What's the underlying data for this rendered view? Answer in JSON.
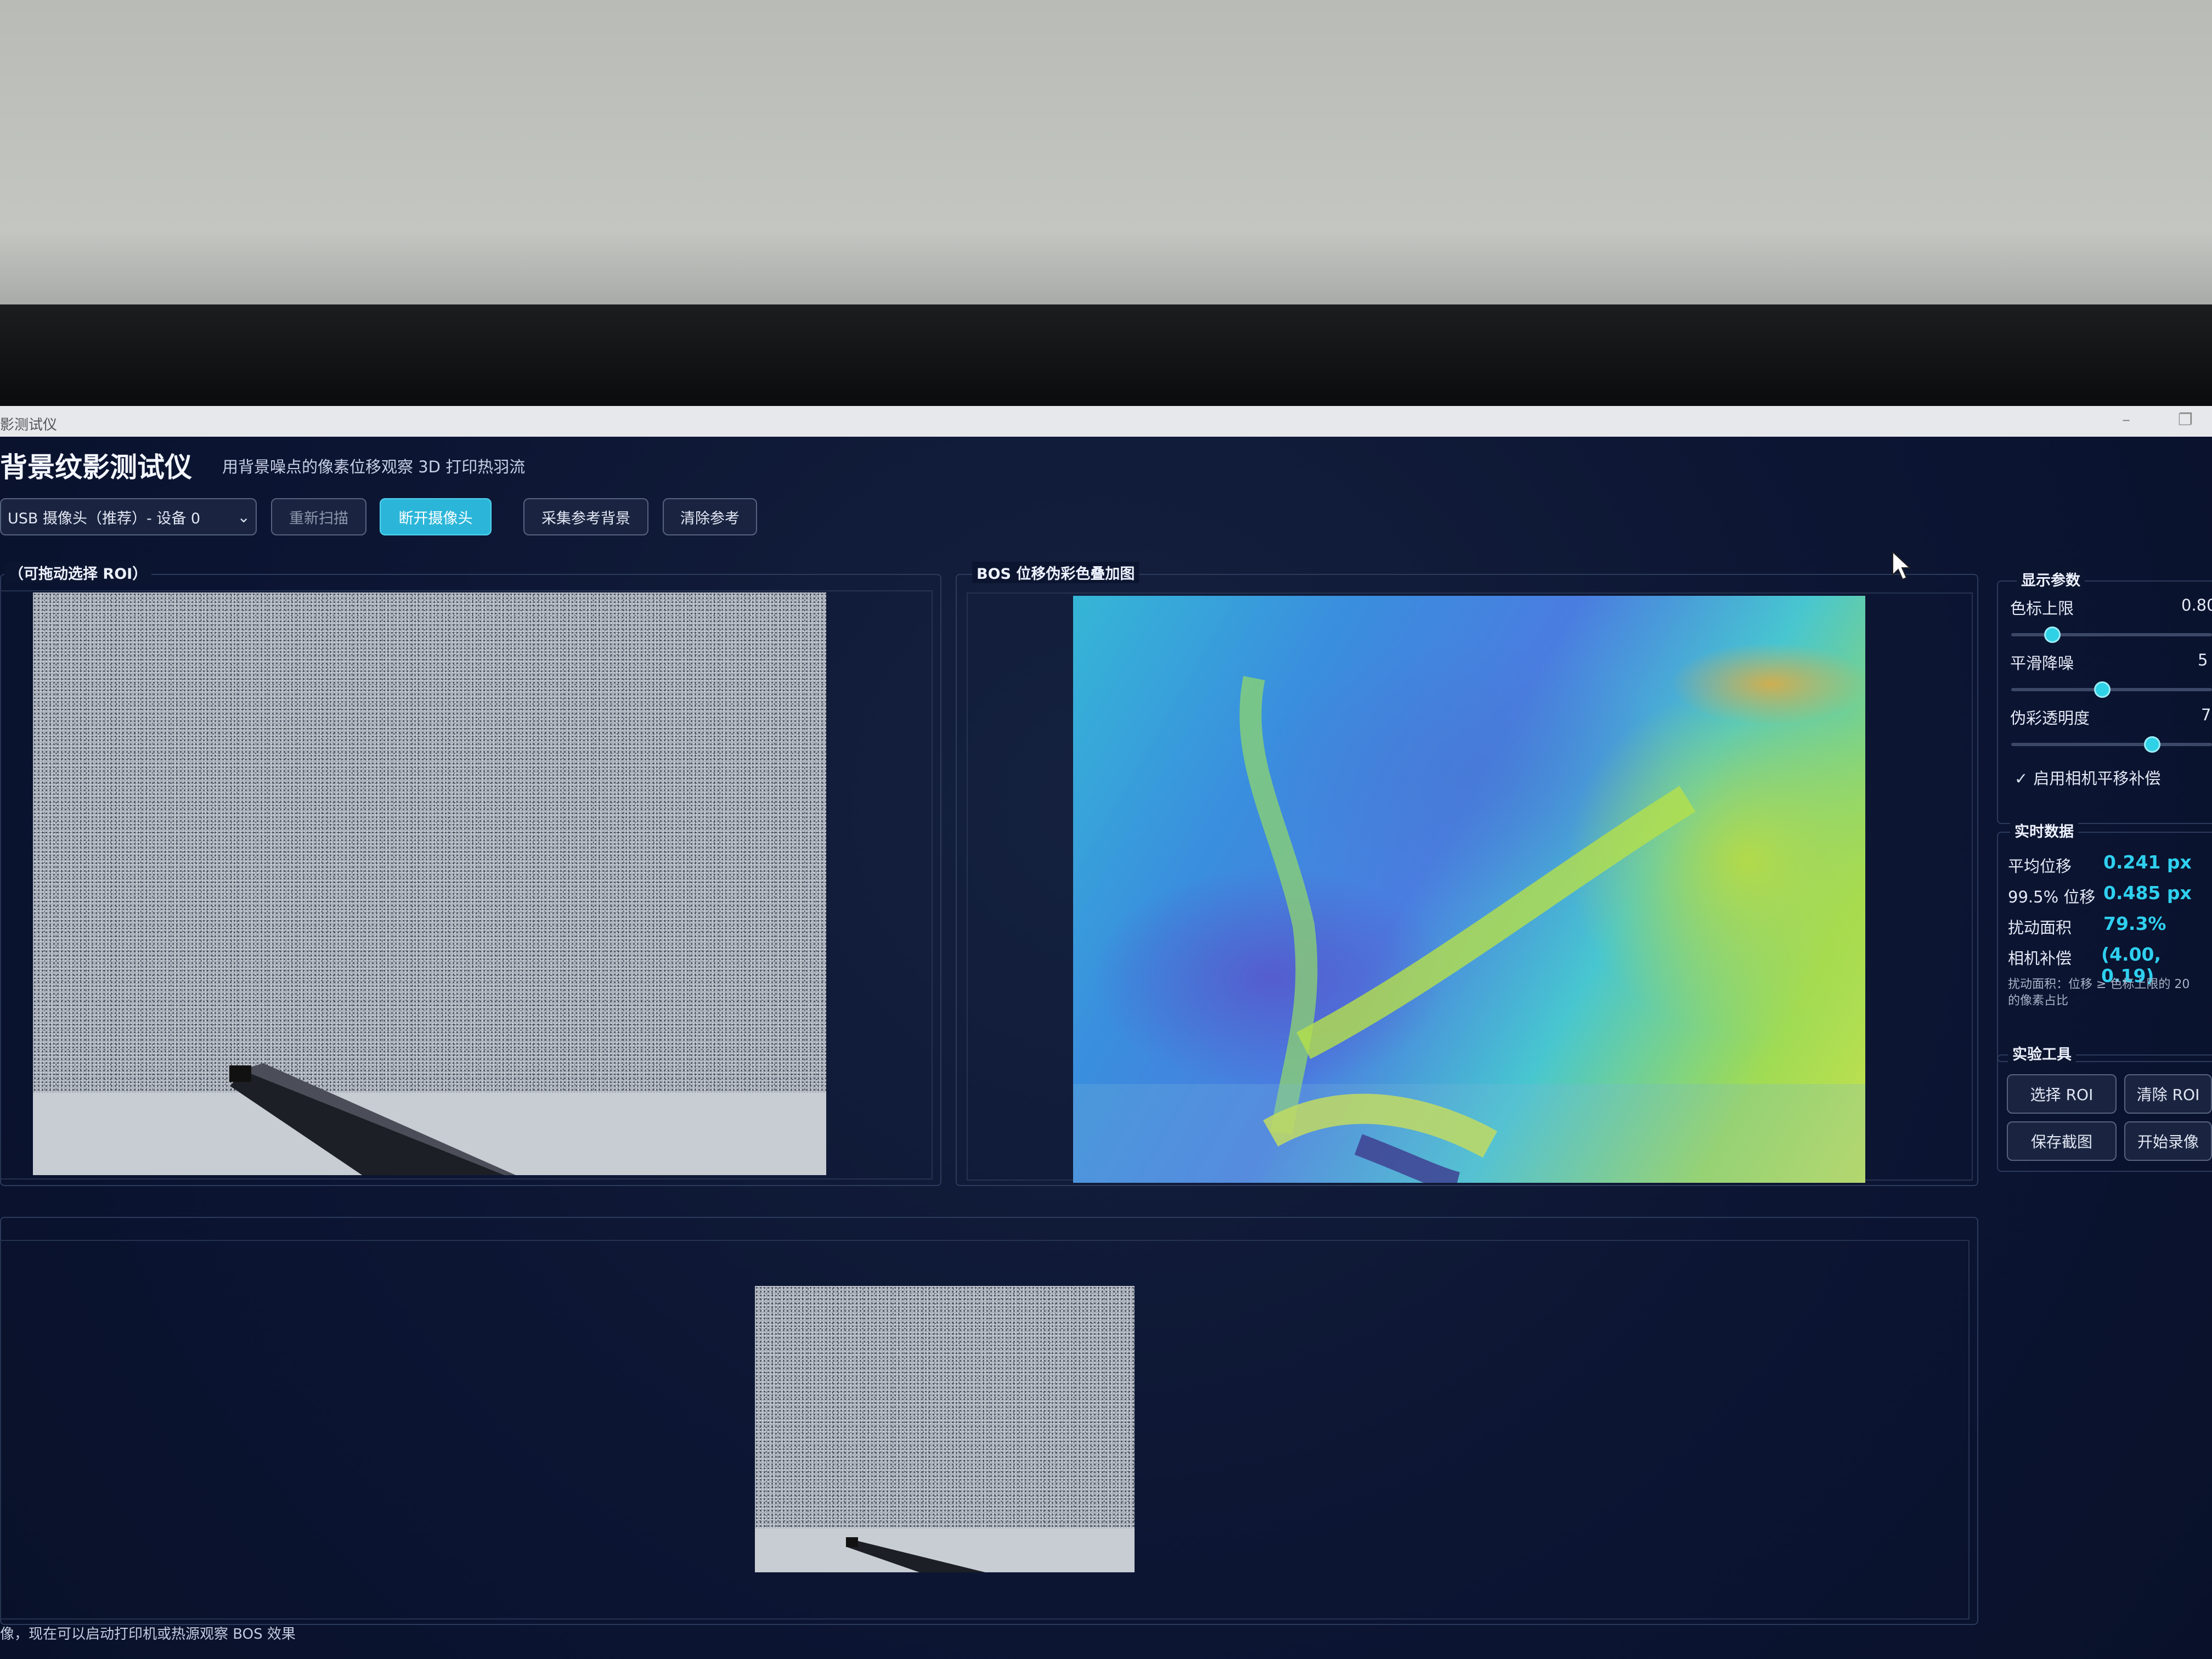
{
  "window": {
    "title": "影测试仪"
  },
  "header": {
    "title": "背景纹影测试仪",
    "subtitle": "用背景噪点的像素位移观察 3D 打印热羽流"
  },
  "toolbar": {
    "camera_select": "USB 摄像头（推荐）- 设备 0",
    "rescan": "重新扫描",
    "disconnect": "断开摄像头",
    "capture_reference": "采集参考背景",
    "clear_reference": "清除参考"
  },
  "panels": {
    "camera": {
      "label": "（可拖动选择 ROI）"
    },
    "bos": {
      "label": "BOS 位移伪彩色叠加图"
    }
  },
  "display_params": {
    "title": "显示参数",
    "colormap_max": {
      "label": "色标上限",
      "value": "0.80",
      "level": 0.18
    },
    "smoothing": {
      "label": "平滑降噪",
      "value": "5",
      "level": 0.45
    },
    "overlay_alpha": {
      "label": "伪彩透明度",
      "value": "7",
      "level": 0.72
    },
    "compensation_label": "启用相机平移补偿",
    "compensation_checked": true
  },
  "realtime": {
    "title": "实时数据",
    "mean_shift": {
      "label": "平均位移",
      "value": "0.241 px"
    },
    "p995_shift": {
      "label": "99.5% 位移",
      "value": "0.485 px"
    },
    "disturbed_area": {
      "label": "扰动面积",
      "value": "79.3%"
    },
    "camera_comp": {
      "label": "相机补偿",
      "value": "(4.00, 0.19)"
    },
    "note_line1": "扰动面积：位移 ≥ 色标上限的 20",
    "note_line2": "的像素占比"
  },
  "tools": {
    "title": "实验工具",
    "select_roi": "选择 ROI",
    "clear_roi": "清除 ROI",
    "save_snapshot": "保存截图",
    "start_recording": "开始录像"
  },
  "status": {
    "text": "像，现在可以启动打印机或热源观察 BOS 效果"
  },
  "colors": {
    "background": "#0c1530",
    "accent": "#2bb6d9",
    "value_text": "#2fd0ef"
  },
  "icons": {
    "checkmark": "check-icon",
    "dropdown": "chevron-down-icon",
    "cursor": "mouse-cursor-icon"
  }
}
